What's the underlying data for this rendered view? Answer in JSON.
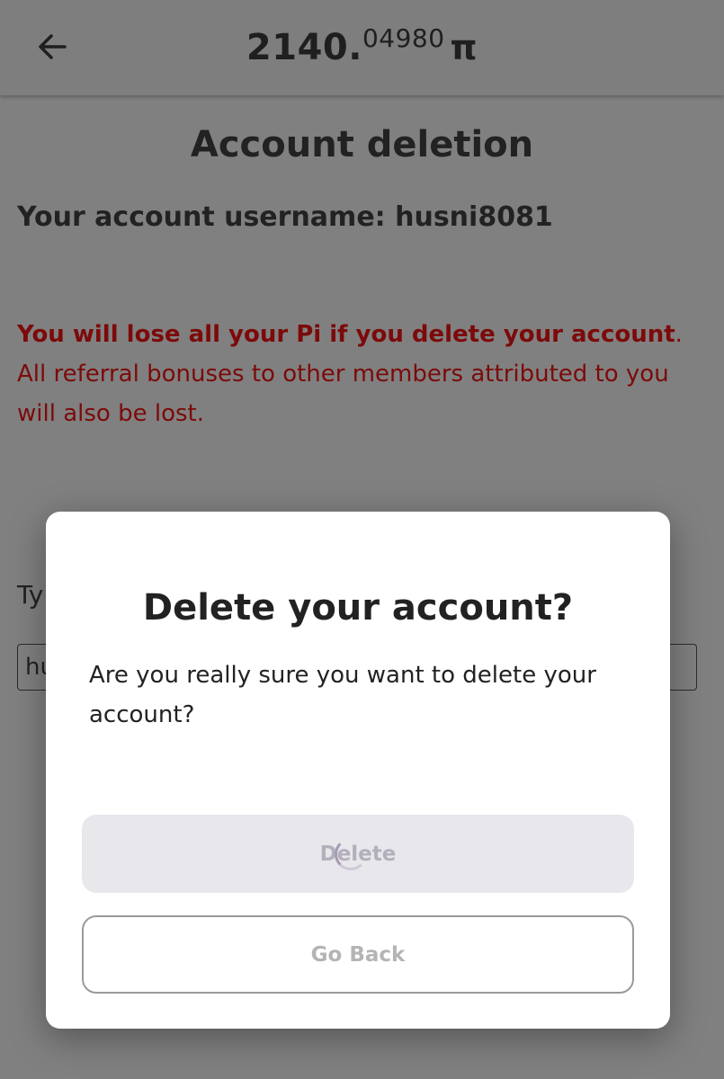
{
  "header": {
    "back_icon": "arrow-left-icon",
    "balance_integer": "2140.",
    "balance_decimal": "04980",
    "currency_symbol": "π"
  },
  "page": {
    "title": "Account deletion",
    "username_label": "Your account username: husni8081",
    "warning_bold": "You will lose all your Pi if you delete your account",
    "warning_rest": ". All referral bonuses to other members attributed to you will also be lost.",
    "type_label_partial": "Ty",
    "input_partial_value": "hu"
  },
  "modal": {
    "title": "Delete your account?",
    "body": "Are you really sure you want to delete your account?",
    "delete_label": "Delete",
    "go_back_label": "Go Back",
    "loading_icon": "spinner-icon"
  },
  "colors": {
    "overlay_gray": "#808080",
    "warning_red": "#7c0a0a",
    "delete_bg": "#e8e7ec",
    "delete_text": "#b3b0bb"
  }
}
